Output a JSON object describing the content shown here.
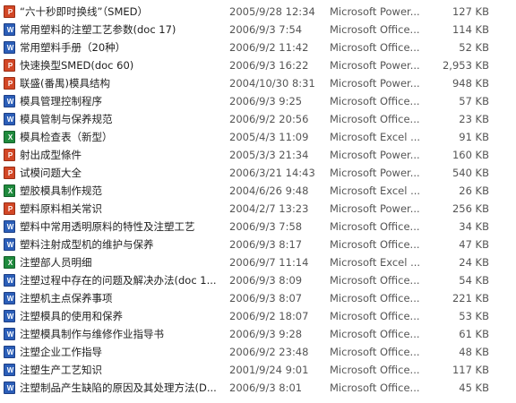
{
  "files": [
    {
      "name": "“六十秒即时换线”（SMED）",
      "date": "2005/9/28 12:34",
      "type": "Microsoft Power...",
      "size": "127 KB",
      "icon": "ppt-file-icon",
      "color": "#d24726"
    },
    {
      "name": "常用塑料的注塑工艺参数(doc 17)",
      "date": "2006/9/3 7:54",
      "type": "Microsoft Office...",
      "size": "114 KB",
      "icon": "word-file-icon",
      "color": "#2b5eb8"
    },
    {
      "name": "常用塑料手册（20种）",
      "date": "2006/9/2 11:42",
      "type": "Microsoft Office...",
      "size": "52 KB",
      "icon": "word-file-icon",
      "color": "#2b5eb8"
    },
    {
      "name": "快速换型SMED(doc 60)",
      "date": "2006/9/3 16:22",
      "type": "Microsoft Power...",
      "size": "2,953 KB",
      "icon": "ppt-file-icon",
      "color": "#d24726"
    },
    {
      "name": "联盛(番禺)模具结构",
      "date": "2004/10/30 8:31",
      "type": "Microsoft Power...",
      "size": "948 KB",
      "icon": "ppt-file-icon",
      "color": "#d24726"
    },
    {
      "name": "模具管理控制程序",
      "date": "2006/9/3 9:25",
      "type": "Microsoft Office...",
      "size": "57 KB",
      "icon": "word-file-icon",
      "color": "#2b5eb8"
    },
    {
      "name": "模具管制与保养规范",
      "date": "2006/9/2 20:56",
      "type": "Microsoft Office...",
      "size": "23 KB",
      "icon": "word-file-icon",
      "color": "#2b5eb8"
    },
    {
      "name": "模具检查表（新型）",
      "date": "2005/4/3 11:09",
      "type": "Microsoft Excel ...",
      "size": "91 KB",
      "icon": "excel-file-icon",
      "color": "#1f8a3d"
    },
    {
      "name": "射出成型條件",
      "date": "2005/3/3 21:34",
      "type": "Microsoft Power...",
      "size": "160 KB",
      "icon": "ppt-file-icon",
      "color": "#d24726"
    },
    {
      "name": "试模问题大全",
      "date": "2006/3/21 14:43",
      "type": "Microsoft Power...",
      "size": "540 KB",
      "icon": "ppt-file-icon",
      "color": "#d24726"
    },
    {
      "name": "塑胶模具制作规范",
      "date": "2004/6/26 9:48",
      "type": "Microsoft Excel ...",
      "size": "26 KB",
      "icon": "excel-file-icon",
      "color": "#1f8a3d"
    },
    {
      "name": "塑料原料相关常识",
      "date": "2004/2/7 13:23",
      "type": "Microsoft Power...",
      "size": "256 KB",
      "icon": "ppt-file-icon",
      "color": "#d24726"
    },
    {
      "name": "塑料中常用透明原料的特性及注塑工艺",
      "date": "2006/9/3 7:58",
      "type": "Microsoft Office...",
      "size": "34 KB",
      "icon": "word-file-icon",
      "color": "#2b5eb8"
    },
    {
      "name": "塑料注射成型机的维护与保养",
      "date": "2006/9/3 8:17",
      "type": "Microsoft Office...",
      "size": "47 KB",
      "icon": "word-file-icon",
      "color": "#2b5eb8"
    },
    {
      "name": "注塑部人员明细",
      "date": "2006/9/7 11:14",
      "type": "Microsoft Excel ...",
      "size": "24 KB",
      "icon": "excel-file-icon",
      "color": "#1f8a3d"
    },
    {
      "name": "注塑过程中存在的问题及解决办法(doc 1...",
      "date": "2006/9/3 8:09",
      "type": "Microsoft Office...",
      "size": "54 KB",
      "icon": "word-file-icon",
      "color": "#2b5eb8"
    },
    {
      "name": "注塑机主点保养事项",
      "date": "2006/9/3 8:07",
      "type": "Microsoft Office...",
      "size": "221 KB",
      "icon": "word-file-icon",
      "color": "#2b5eb8"
    },
    {
      "name": "注塑模具的使用和保养",
      "date": "2006/9/2 18:07",
      "type": "Microsoft Office...",
      "size": "53 KB",
      "icon": "word-file-icon",
      "color": "#2b5eb8"
    },
    {
      "name": "注塑模具制作与维修作业指导书",
      "date": "2006/9/3 9:28",
      "type": "Microsoft Office...",
      "size": "61 KB",
      "icon": "word-file-icon",
      "color": "#2b5eb8"
    },
    {
      "name": "注塑企业工作指导",
      "date": "2006/9/2 23:48",
      "type": "Microsoft Office...",
      "size": "48 KB",
      "icon": "word-file-icon",
      "color": "#2b5eb8"
    },
    {
      "name": "注塑生产工艺知识",
      "date": "2001/9/24 9:01",
      "type": "Microsoft Office...",
      "size": "117 KB",
      "icon": "word-file-icon",
      "color": "#2b5eb8"
    },
    {
      "name": "注塑制品产生缺陷的原因及其处理方法(D...",
      "date": "2006/9/3 8:01",
      "type": "Microsoft Office...",
      "size": "45 KB",
      "icon": "word-file-icon",
      "color": "#2b5eb8"
    }
  ]
}
